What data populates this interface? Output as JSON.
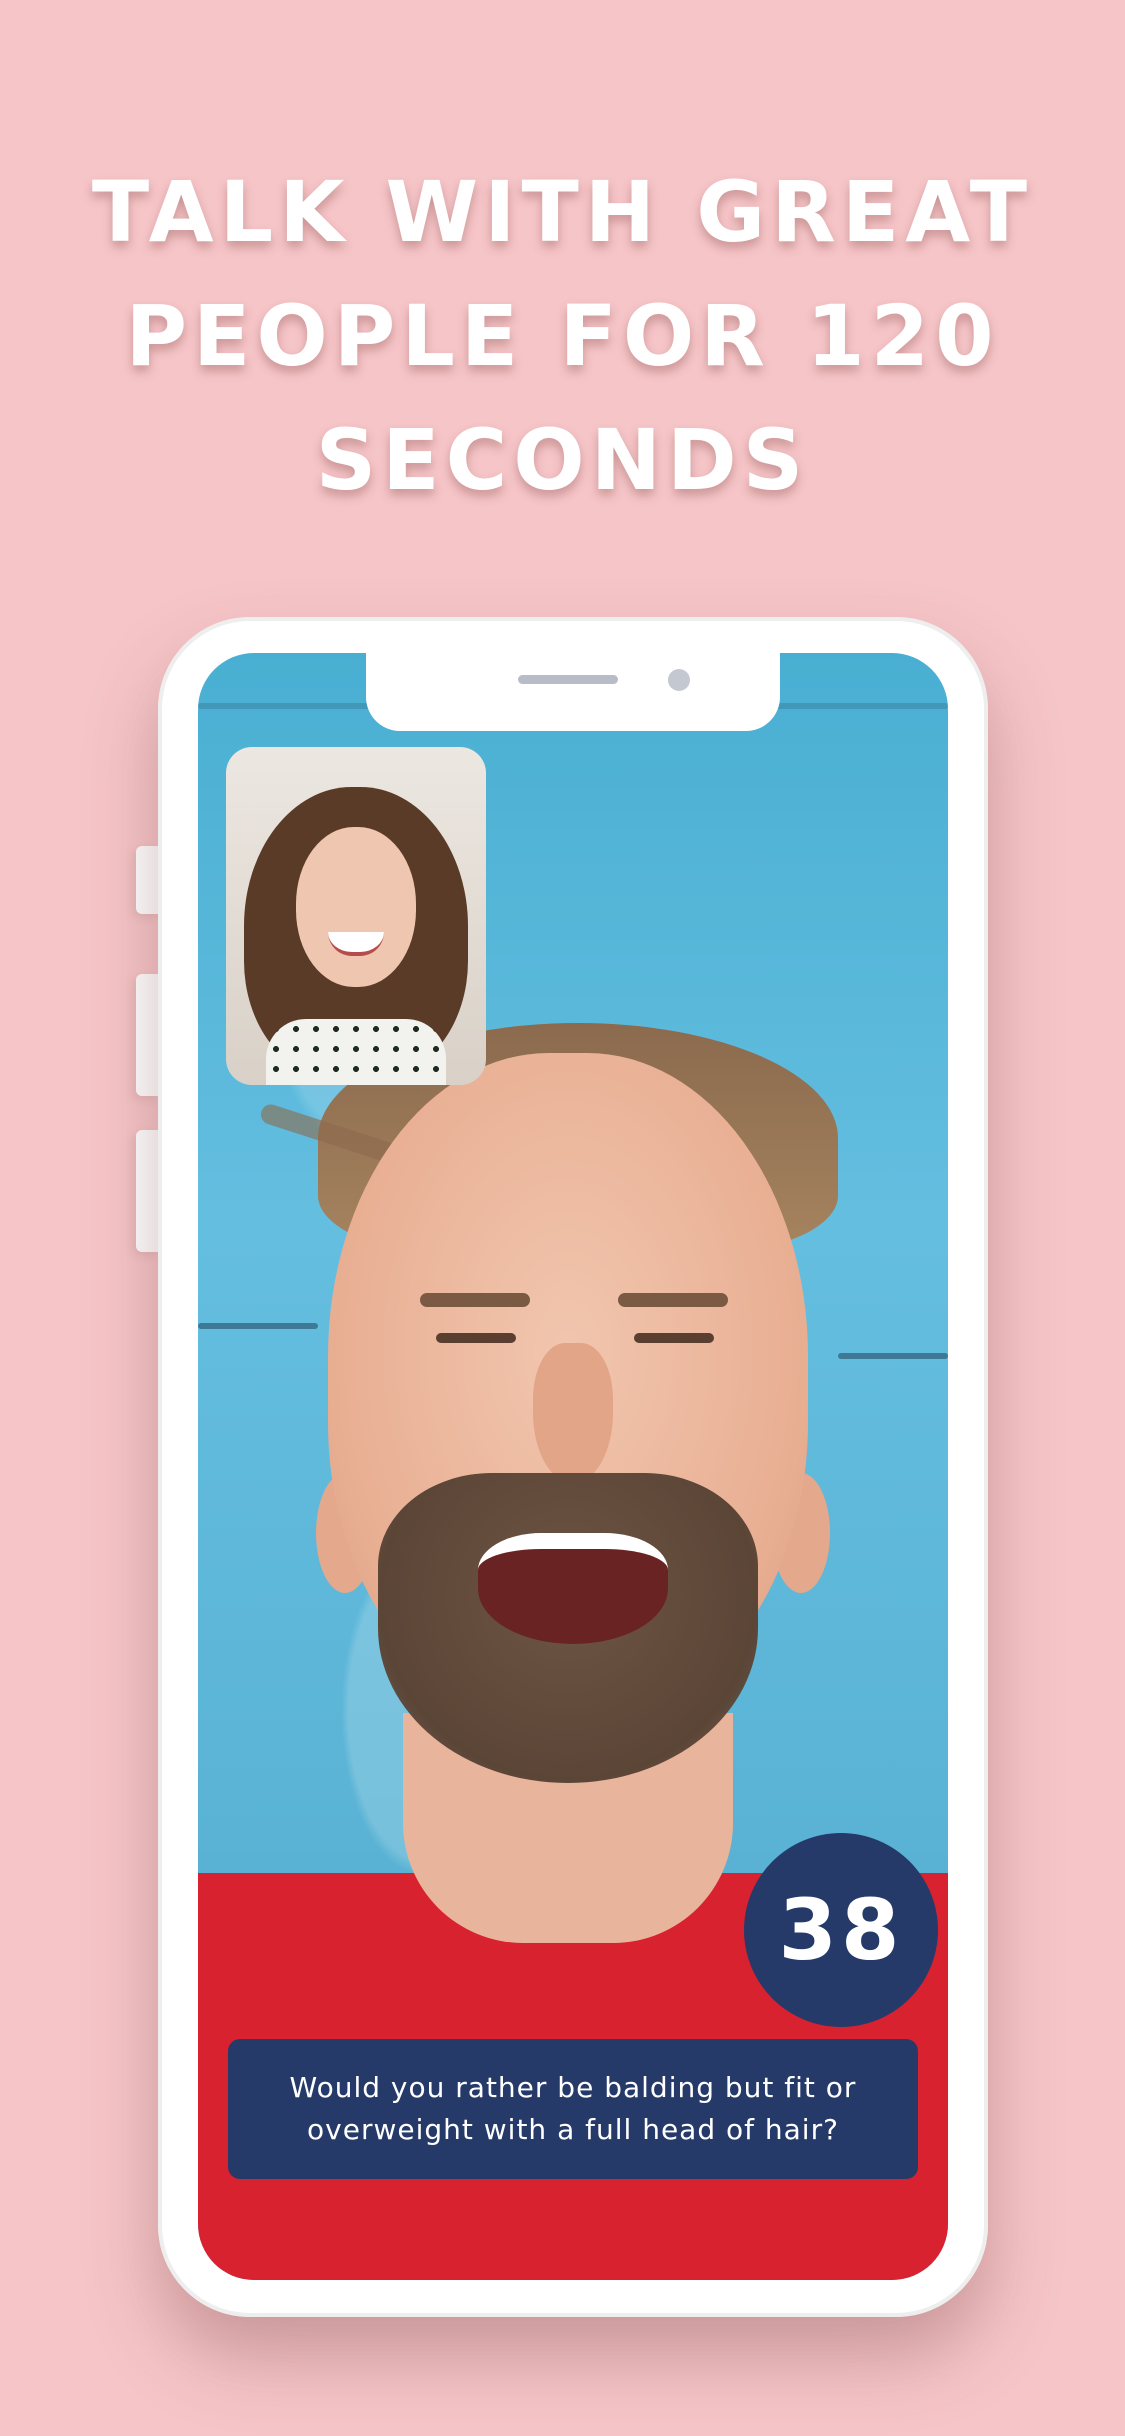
{
  "headline": {
    "line1": "TALK WITH GREAT",
    "line2": "PEOPLE FOR 120",
    "line3": "SECONDS"
  },
  "call": {
    "timer_value": "38",
    "question_text": "Would you rather be balding but fit or overweight with a full head of hair?"
  },
  "colors": {
    "background": "#f6c5c7",
    "accent_navy": "#263a6a",
    "wall_blue": "#5bb4d6",
    "sweater_red": "#d82230"
  }
}
